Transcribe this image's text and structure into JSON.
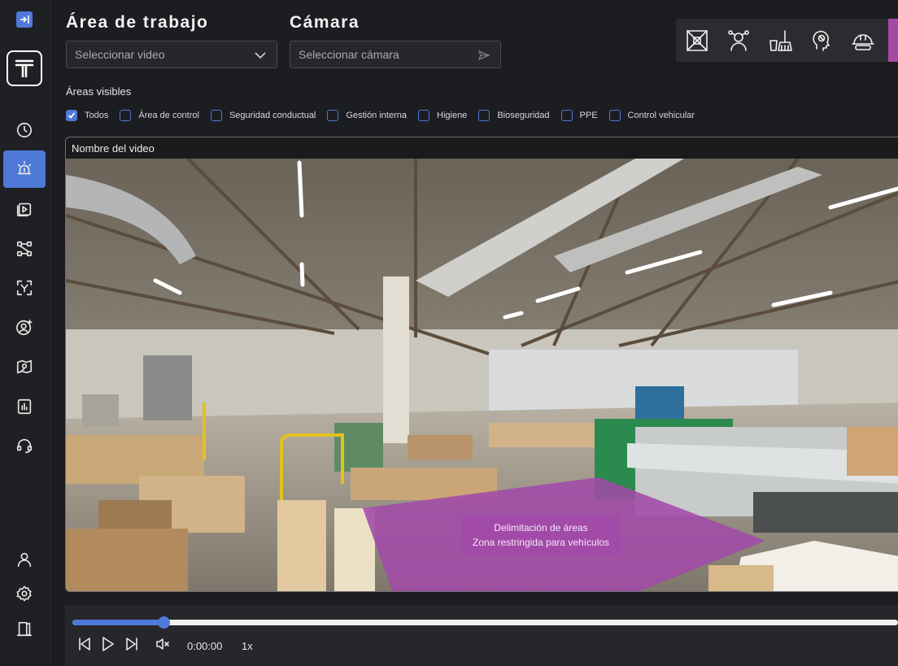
{
  "header": {
    "workspace_title": "Área de trabajo",
    "camera_title": "Cámara",
    "video_select_placeholder": "Seleccionar video",
    "camera_select_placeholder": "Seleccionar cámara"
  },
  "filters": {
    "label": "Áreas visibles",
    "options": [
      {
        "label": "Todos",
        "checked": true
      },
      {
        "label": "Área de control",
        "checked": false
      },
      {
        "label": "Seguridad conductual",
        "checked": false
      },
      {
        "label": "Gestión interna",
        "checked": false
      },
      {
        "label": "Higiene",
        "checked": false
      },
      {
        "label": "Bioseguridad",
        "checked": false
      },
      {
        "label": "PPE",
        "checked": false
      },
      {
        "label": "Control vehicular",
        "checked": false
      }
    ]
  },
  "video": {
    "title": "Nombre del video",
    "overlay_line1": "Delimitación de áreas",
    "overlay_line2": "Zona restringida para vehículos"
  },
  "player": {
    "time": "0:00:00",
    "speed": "1x",
    "progress": 0.11
  },
  "toolbar": {
    "icons": [
      "area-frame-icon",
      "worker-behavior-icon",
      "cleaning-icon",
      "hygiene-head-icon",
      "hard-hat-icon"
    ]
  },
  "sidebar": {
    "icons": [
      "history-icon",
      "alarm-icon",
      "video-library-icon",
      "workflow-icon",
      "scan-icon",
      "add-user-icon",
      "map-icon",
      "report-icon",
      "support-icon",
      "profile-icon",
      "settings-icon",
      "logout-icon"
    ],
    "active": "alarm-icon"
  },
  "colors": {
    "accent": "#4f79d8",
    "zone": "#a24aa8",
    "background": "#1c1d21"
  }
}
